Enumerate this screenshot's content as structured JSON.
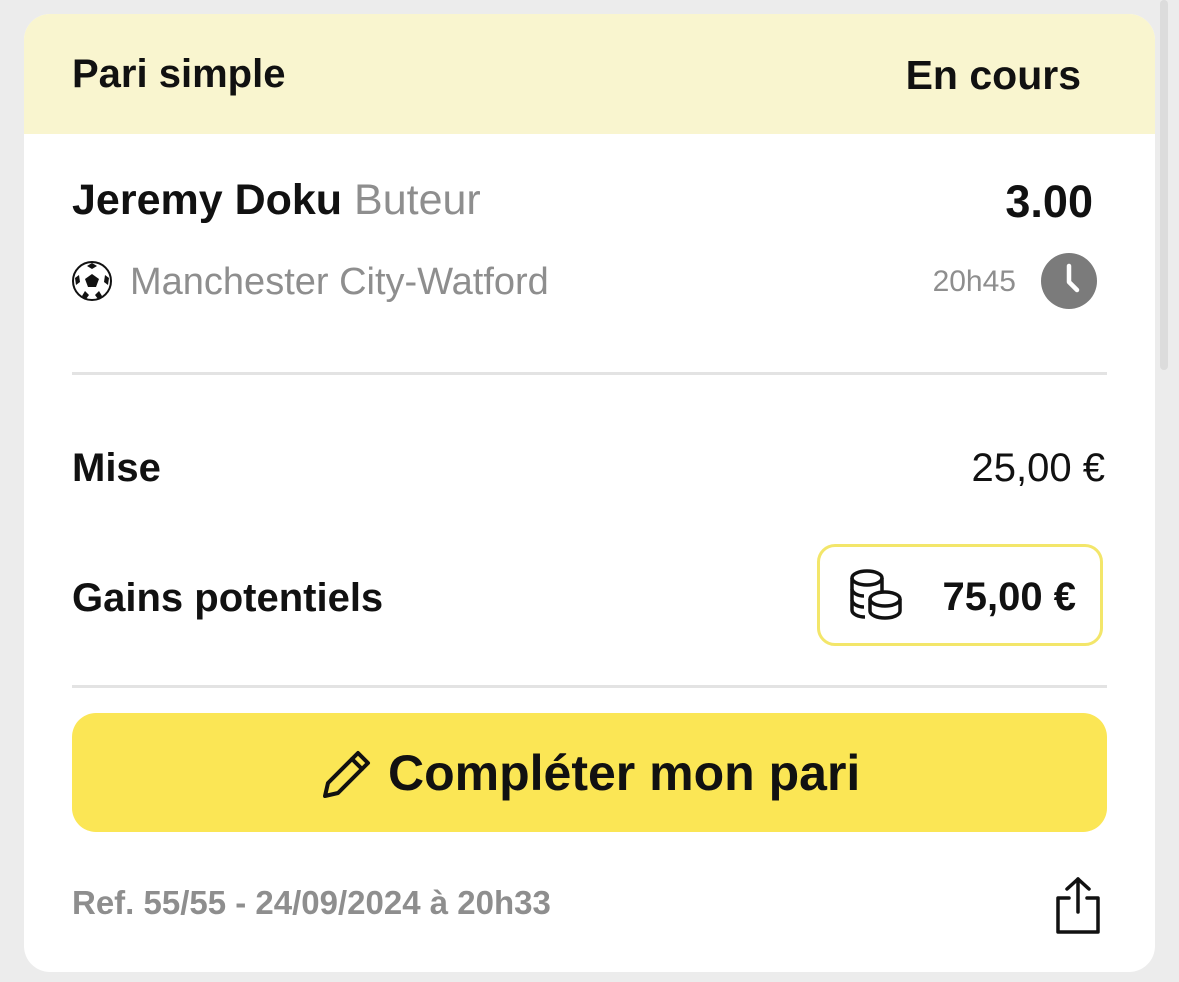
{
  "bet_card": {
    "header": {
      "bet_type": "Pari simple",
      "status": "En cours"
    },
    "selection": {
      "player": "Jeremy Doku",
      "market": "Buteur",
      "odds": "3.00",
      "sport_icon": "soccer-ball-icon",
      "match": "Manchester City-Watford",
      "kickoff_time": "20h45",
      "time_icon": "clock-icon"
    },
    "stake": {
      "label": "Mise",
      "value": "25,00 €"
    },
    "potential_gains": {
      "label": "Gains potentiels",
      "value": "75,00 €",
      "icon": "coins-icon"
    },
    "complete_button": {
      "label": "Compléter mon pari",
      "icon": "pencil-icon"
    },
    "footer": {
      "reference": "Ref. 55/55 - 24/09/2024 à 20h33",
      "share_icon": "share-icon"
    }
  },
  "colors": {
    "header_background": "#f9f5cf",
    "accent_yellow": "#fbe655",
    "gains_border": "#f3e66a",
    "muted_text": "#8e8e8e",
    "page_background": "#ececec"
  }
}
